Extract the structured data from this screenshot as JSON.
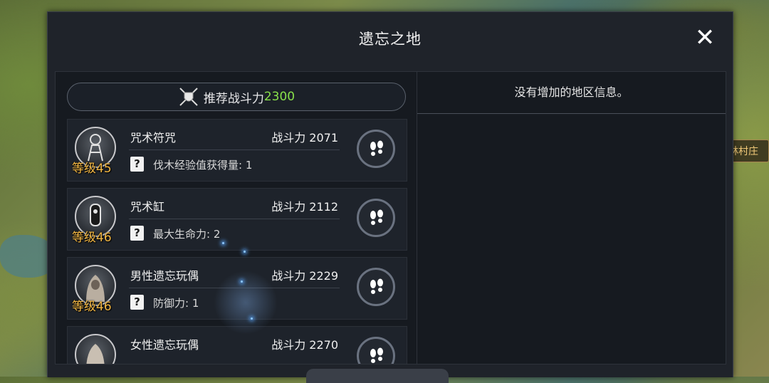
{
  "map": {
    "location_label": "林村庄"
  },
  "dialog": {
    "title": "遗忘之地",
    "close_icon": "close-icon"
  },
  "recommended": {
    "label": "推荐战斗力",
    "value": "2300",
    "icon": "crossed-swords-shield-icon",
    "value_color": "#88e04a"
  },
  "right_panel": {
    "info_text": "没有增加的地区信息。"
  },
  "monsters": [
    {
      "name": "咒术符咒",
      "level": "等级45",
      "power": "战斗力 2071",
      "bonus": "伐木经验值获得量: 1"
    },
    {
      "name": "咒术缸",
      "level": "等级46",
      "power": "战斗力 2112",
      "bonus": "最大生命力: 2"
    },
    {
      "name": "男性遗忘玩偶",
      "level": "等级46",
      "power": "战斗力 2229",
      "bonus": "防御力: 1"
    },
    {
      "name": "女性遗忘玩偶",
      "level": "",
      "power": "战斗力 2270",
      "bonus": ""
    }
  ],
  "colors": {
    "level": "#f3b743",
    "dialog_bg": "#1f232a"
  }
}
